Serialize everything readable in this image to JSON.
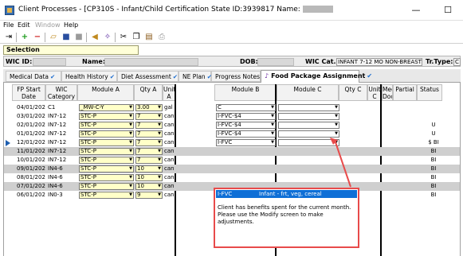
{
  "window": {
    "title_prefix": "Client Processes - [CP310S - Infant/Child Certification  State ID:3939817  Name:",
    "minimize": "—",
    "maximize": "☐",
    "close": "✕"
  },
  "menu": [
    "File",
    "Edit",
    "Window",
    "Help"
  ],
  "selection_label": "Selection",
  "client": {
    "wic_id_label": "WIC ID:",
    "name_label": "Name:",
    "dob_label": "DOB:",
    "wic_cat_label": "WIC Cat.:",
    "wic_cat_value": "INFANT 7-12 MO NON-BREASTFEE",
    "tr_type_label": "Tr.Type:",
    "tr_type_value": "C"
  },
  "tabs": [
    {
      "label": "Medical Data",
      "check": "✔"
    },
    {
      "label": "Health History",
      "check": "✔"
    },
    {
      "label": "Diet Assessment",
      "check": "✔"
    },
    {
      "label": "NE Plan",
      "check": "✔"
    },
    {
      "label": "Progress Notes",
      "check": ""
    },
    {
      "label": "Food Package Assignment",
      "check": "✔"
    }
  ],
  "headers": {
    "fp_start": "FP Start Date",
    "wic_cat": "WIC Category",
    "module_a": "Module A",
    "qty_a": "Qty A",
    "unit_a": "Unit A",
    "module_b": "Module B",
    "module_c": "Module C",
    "qty_c": "Qty C",
    "unit_c": "Unit C",
    "med_doc": "Med Doc",
    "partial": "Partial",
    "status": "Status"
  },
  "rows": [
    {
      "date": "04/01/2024",
      "cat": "C1",
      "mod_a": "_MW-C-Y",
      "qty_a": "3.00",
      "unit_a": "gal",
      "mod_b": "C",
      "mod_c": "",
      "status": ""
    },
    {
      "date": "03/01/2024",
      "cat": "IN7-12",
      "mod_a": "STC-P",
      "qty_a": "7",
      "unit_a": "can",
      "mod_b": "I-FVC-$4",
      "mod_c": "",
      "status": ""
    },
    {
      "date": "02/01/2024",
      "cat": "IN7-12",
      "mod_a": "STC-P",
      "qty_a": "7",
      "unit_a": "can",
      "mod_b": "I-FVC-$4",
      "mod_c": "",
      "status": "U"
    },
    {
      "date": "01/01/2024",
      "cat": "IN7-12",
      "mod_a": "STC-P",
      "qty_a": "7",
      "unit_a": "can",
      "mod_b": "I-FVC-$4",
      "mod_c": "",
      "status": "U"
    },
    {
      "date": "12/01/2023",
      "cat": "IN7-12",
      "mod_a": "STC-P",
      "qty_a": "7",
      "unit_a": "can",
      "mod_b": "I-FVC",
      "mod_c": "",
      "status": "$ BI"
    },
    {
      "date": "11/01/2023",
      "cat": "IN7-12",
      "mod_a": "STC-P",
      "qty_a": "7",
      "unit_a": "can",
      "mod_b": "",
      "mod_c": "",
      "status": "BI"
    },
    {
      "date": "10/01/2023",
      "cat": "IN7-12",
      "mod_a": "STC-P",
      "qty_a": "7",
      "unit_a": "can",
      "mod_b": "",
      "mod_c": "",
      "status": "BI"
    },
    {
      "date": "09/01/2023",
      "cat": "IN4-6",
      "mod_a": "STC-P",
      "qty_a": "10",
      "unit_a": "can",
      "mod_b": "",
      "mod_c": "",
      "status": "BI"
    },
    {
      "date": "08/01/2023",
      "cat": "IN4-6",
      "mod_a": "STC-P",
      "qty_a": "10",
      "unit_a": "can",
      "mod_b": "",
      "mod_c": "",
      "status": "BI"
    },
    {
      "date": "07/01/2023",
      "cat": "IN4-6",
      "mod_a": "STC-P",
      "qty_a": "10",
      "unit_a": "can",
      "mod_b": "",
      "mod_c": "",
      "status": "BI"
    },
    {
      "date": "06/01/2023",
      "cat": "IN0-3",
      "mod_a": "STC-P",
      "qty_a": "9",
      "unit_a": "can",
      "mod_b": "",
      "mod_c": "",
      "status": "BI"
    }
  ],
  "popup": {
    "option_code": "I-FVC",
    "option_desc": "Infant - frt, veg, cereal",
    "message": "Client has benefits spent for the current month. Please use the Modify screen to make adjustments."
  },
  "colors": {
    "callout": "#e84b4b",
    "selection_blue": "#0f6fd6",
    "row_gray": "#cfcfcf",
    "module_a_yellow": "#ffffc8"
  }
}
